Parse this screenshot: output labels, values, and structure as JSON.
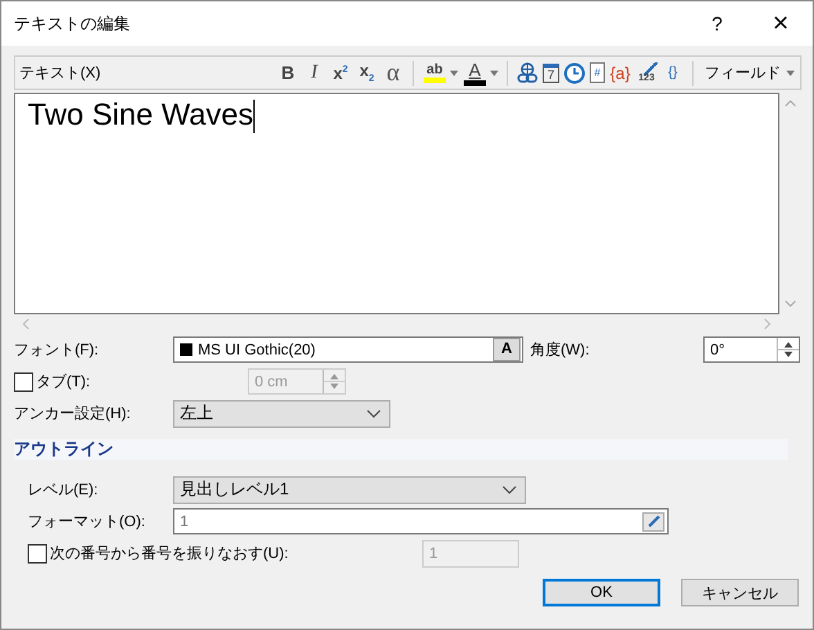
{
  "window": {
    "title": "テキストの編集",
    "help": "?",
    "close": "×"
  },
  "toolbar": {
    "label": "テキスト(X)",
    "items": [
      {
        "kind": "bold",
        "text": "B"
      },
      {
        "kind": "italic",
        "text": "I"
      },
      {
        "kind": "script",
        "text": "x$^{2}$"
      },
      {
        "kind": "script",
        "text": "x$_{2}$"
      },
      {
        "kind": "symbol",
        "text": "α"
      },
      {
        "kind": "highlight",
        "text": "ab"
      },
      {
        "kind": "fontcolor",
        "text": "A"
      },
      {
        "kind": "link"
      },
      {
        "kind": "calendar",
        "text": "7"
      },
      {
        "kind": "clock"
      },
      {
        "kind": "doc",
        "text": "#"
      },
      {
        "kind": "var",
        "text": "{a}"
      },
      {
        "kind": "numfmt",
        "text": "123"
      },
      {
        "kind": "code",
        "text": "{}"
      }
    ],
    "field_menu": "フィールド"
  },
  "editor": {
    "value": "Two Sine Waves"
  },
  "font": {
    "label": "フォント(F):",
    "value": "MS UI Gothic(20)",
    "button": "A"
  },
  "angle": {
    "label": "角度(W):",
    "value": "0°"
  },
  "tab": {
    "label": "タブ(T):",
    "checked": false,
    "value": "0 cm",
    "disabled": true
  },
  "anchor": {
    "label": "アンカー設定(H):",
    "value": "左上"
  },
  "outline": {
    "title": "アウトライン",
    "level": {
      "label": "レベル(E):",
      "value": "見出しレベル1"
    },
    "format": {
      "label": "フォーマット(O):",
      "value": "1"
    },
    "renumber": {
      "label": "次の番号から番号を振りなおす(U):",
      "checked": false,
      "value": "1",
      "disabled": true
    }
  },
  "buttons": [
    {
      "label": "OK",
      "selected": true
    },
    {
      "label": "キャンセル",
      "selected": false
    }
  ]
}
